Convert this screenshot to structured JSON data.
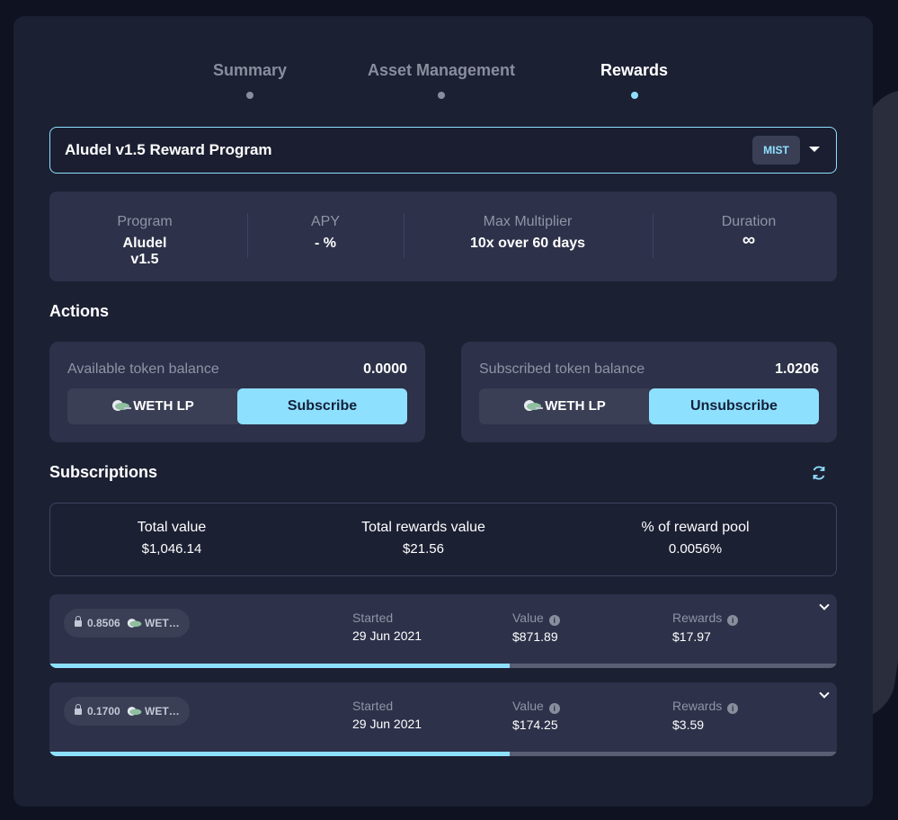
{
  "tabs": [
    {
      "label": "Summary",
      "active": false
    },
    {
      "label": "Asset Management",
      "active": false
    },
    {
      "label": "Rewards",
      "active": true
    }
  ],
  "program_select": {
    "label": "Aludel v1.5 Reward Program",
    "token": "MIST"
  },
  "stats": [
    {
      "key": "Program",
      "value": "Aludel v1.5"
    },
    {
      "key": "APY",
      "value": "- %"
    },
    {
      "key": "Max Multiplier",
      "value": "10x over 60 days"
    },
    {
      "key": "Duration",
      "value": "∞"
    }
  ],
  "actions": {
    "title": "Actions",
    "available": {
      "label": "Available token balance",
      "value": "0.0000",
      "token": "WETH LP",
      "button": "Subscribe"
    },
    "subscribed": {
      "label": "Subscribed token balance",
      "value": "1.0206",
      "token": "WETH LP",
      "button": "Unsubscribe"
    }
  },
  "subscriptions": {
    "title": "Subscriptions",
    "totals": [
      {
        "key": "Total value",
        "value": "$1,046.14"
      },
      {
        "key": "Total rewards value",
        "value": "$21.56"
      },
      {
        "key": "% of reward pool",
        "value": "0.0056%"
      }
    ],
    "rows": [
      {
        "amount": "0.8506",
        "token": "WET…",
        "started_label": "Started",
        "started": "29 Jun 2021",
        "value_label": "Value",
        "value": "$871.89",
        "rewards_label": "Rewards",
        "rewards": "$17.97",
        "progress": 0.585
      },
      {
        "amount": "0.1700",
        "token": "WET…",
        "started_label": "Started",
        "started": "29 Jun 2021",
        "value_label": "Value",
        "value": "$174.25",
        "rewards_label": "Rewards",
        "rewards": "$3.59",
        "progress": 0.585
      }
    ]
  },
  "colors": {
    "accent": "#8ee0ff",
    "card": "#1c2033",
    "panel": "#2d3149"
  }
}
